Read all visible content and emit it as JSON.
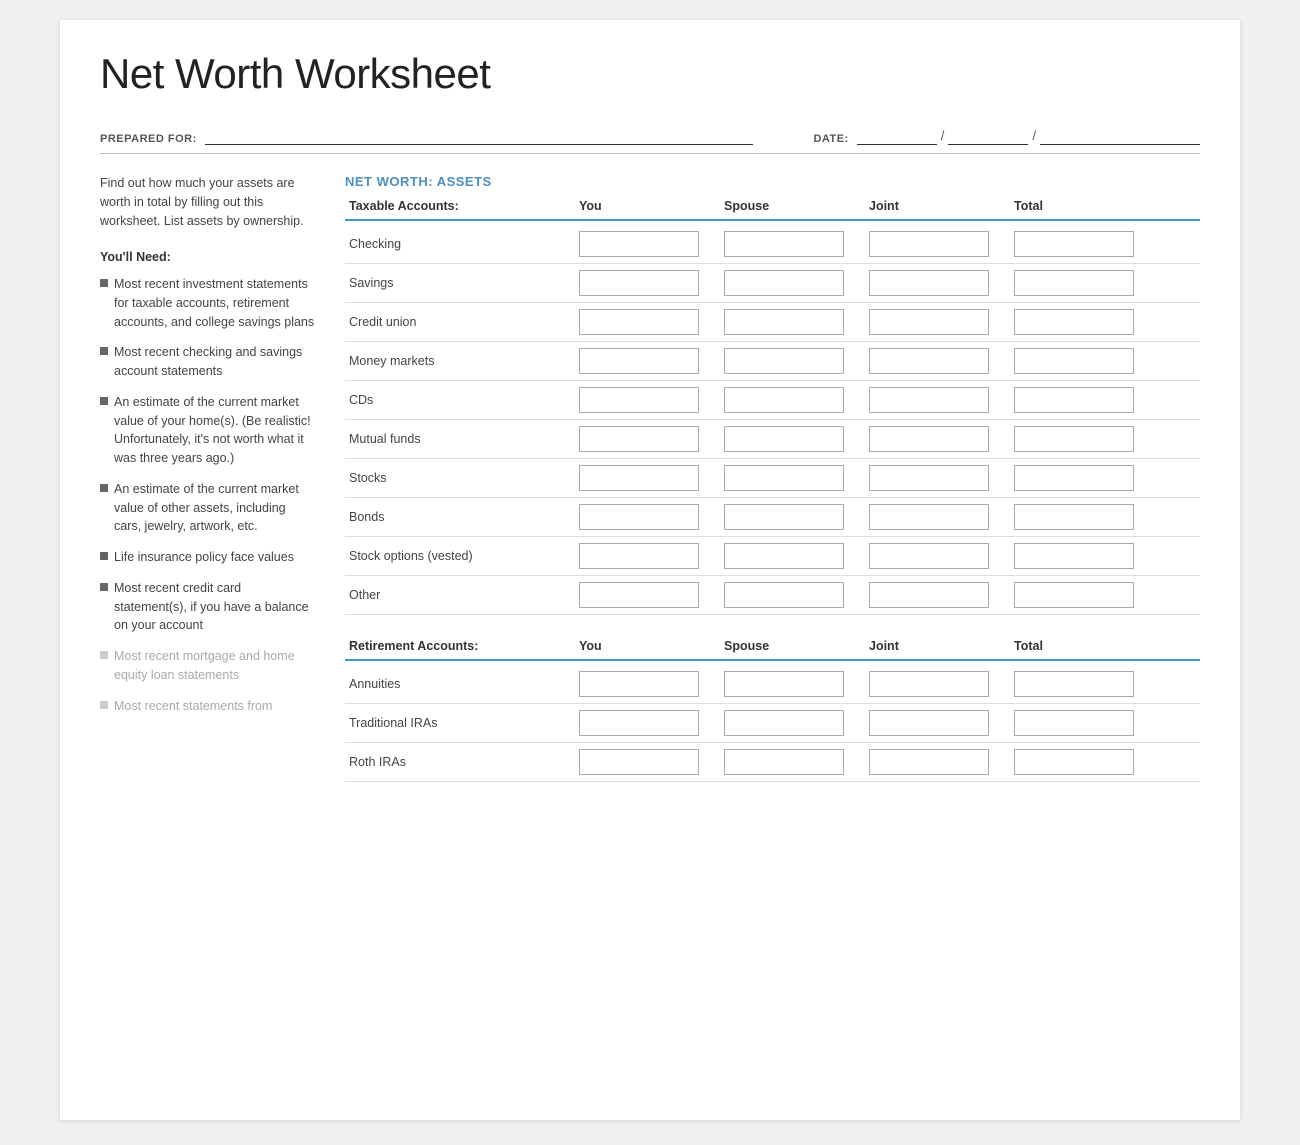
{
  "page": {
    "title": "Net Worth Worksheet",
    "prepared_for_label": "PREPARED FOR:",
    "date_label": "DATE:",
    "date_slash1": "/",
    "date_slash2": "/"
  },
  "sidebar": {
    "intro": "Find out how much your assets are worth in total by filling out this worksheet. List assets by ownership.",
    "need_title": "You'll Need:",
    "items": [
      {
        "text": "Most recent investment statements for taxable accounts, retirement accounts, and college savings plans",
        "faded": false
      },
      {
        "text": "Most recent checking and savings account statements",
        "faded": false
      },
      {
        "text": "An estimate of the current market value of your home(s). (Be realistic! Unfortunately, it's not worth what it was three years ago.)",
        "faded": false
      },
      {
        "text": "An estimate of the current market value of other assets, including cars, jewelry, artwork, etc.",
        "faded": false
      },
      {
        "text": "Life insurance policy face values",
        "faded": false
      },
      {
        "text": "Most recent credit card statement(s), if you have a balance on your account",
        "faded": false
      },
      {
        "text": "Most recent mortgage and home equity loan statements",
        "faded": true
      },
      {
        "text": "Most recent statements from",
        "faded": true
      }
    ]
  },
  "net_worth": {
    "section_label": "NET WORTH:",
    "section_type": "ASSETS",
    "taxable": {
      "section_title": "Taxable Accounts:",
      "col_you": "You",
      "col_spouse": "Spouse",
      "col_joint": "Joint",
      "col_total": "Total",
      "rows": [
        "Checking",
        "Savings",
        "Credit union",
        "Money markets",
        "CDs",
        "Mutual funds",
        "Stocks",
        "Bonds",
        "Stock options (vested)",
        "Other"
      ]
    },
    "retirement": {
      "section_title": "Retirement Accounts:",
      "col_you": "You",
      "col_spouse": "Spouse",
      "col_joint": "Joint",
      "col_total": "Total",
      "rows": [
        "Annuities",
        "Traditional IRAs",
        "Roth IRAs"
      ]
    }
  }
}
